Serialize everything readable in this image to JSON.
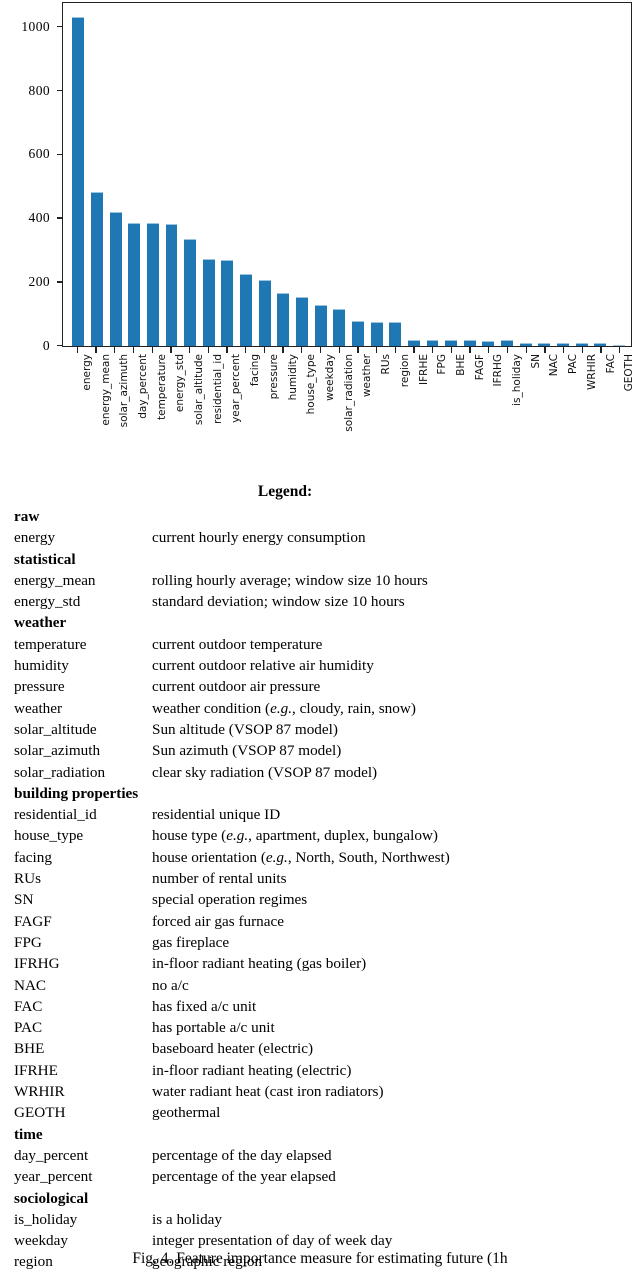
{
  "chart_data": {
    "type": "bar",
    "title": "",
    "xlabel": "",
    "ylabel": "",
    "ylim": [
      0,
      1075
    ],
    "yticks": [
      "0",
      "200",
      "400",
      "600",
      "800",
      "1000"
    ],
    "grid": false,
    "legend_position": "none",
    "bar_color": "#1f77b4",
    "categories": [
      "energy",
      "energy_mean",
      "solar_azimuth",
      "day_percent",
      "temperature",
      "energy_std",
      "solar_altitude",
      "residential_id",
      "year_percent",
      "facing",
      "pressure",
      "humidity",
      "house_type",
      "weekday",
      "solar_radiation",
      "weather",
      "RUs",
      "region",
      "IFRHE",
      "FPG",
      "BHE",
      "FAGF",
      "IFRHG",
      "is_holiday",
      "SN",
      "NAC",
      "PAC",
      "WRHIR",
      "FAC",
      "GEOTH"
    ],
    "values": [
      1034,
      484,
      422,
      388,
      386,
      383,
      337,
      272,
      270,
      227,
      207,
      167,
      153,
      130,
      117,
      80,
      77,
      74,
      20,
      20,
      20,
      18,
      17,
      18,
      10,
      9,
      9,
      10,
      10,
      3
    ]
  },
  "legend": {
    "title": "Legend:",
    "sections": [
      {
        "group": "raw",
        "rows": [
          {
            "term": "energy",
            "desc": "current hourly energy consumption"
          }
        ]
      },
      {
        "group": "statistical",
        "rows": [
          {
            "term": "energy_mean",
            "desc": "rolling hourly average; window size 10 hours"
          },
          {
            "term": "energy_std",
            "desc": "standard deviation; window size 10 hours"
          }
        ]
      },
      {
        "group": "weather",
        "rows": [
          {
            "term": "temperature",
            "desc": "current outdoor temperature"
          },
          {
            "term": "humidity",
            "desc": "current outdoor relative air humidity"
          },
          {
            "term": "pressure",
            "desc": "current outdoor air pressure"
          },
          {
            "term": "weather",
            "desc_html": "weather condition (<i>e.g.</i>, cloudy, rain, snow)"
          },
          {
            "term": "solar_altitude",
            "desc": "Sun altitude (VSOP 87 model)"
          },
          {
            "term": "solar_azimuth",
            "desc": "Sun azimuth (VSOP 87 model)"
          },
          {
            "term": "solar_radiation",
            "desc": "clear sky radiation (VSOP 87 model)"
          }
        ]
      },
      {
        "group": "building properties",
        "rows": [
          {
            "term": "residential_id",
            "desc": "residential unique ID"
          },
          {
            "term": "house_type",
            "desc_html": "house type (<i>e.g.</i>, apartment, duplex, bungalow)"
          },
          {
            "term": "facing",
            "desc_html": "house orientation (<i>e.g.</i>, North, South, Northwest)"
          },
          {
            "term": "RUs",
            "desc": "number of rental units"
          },
          {
            "term": "SN",
            "desc": "special operation regimes"
          },
          {
            "term": "FAGF",
            "desc": "forced air gas furnace"
          },
          {
            "term": "FPG",
            "desc": "gas fireplace"
          },
          {
            "term": "IFRHG",
            "desc": "in-floor radiant heating (gas boiler)"
          },
          {
            "term": "NAC",
            "desc": "no a/c"
          },
          {
            "term": "FAC",
            "desc": "has fixed a/c unit"
          },
          {
            "term": "PAC",
            "desc": "has portable a/c unit"
          },
          {
            "term": "BHE",
            "desc": "baseboard heater (electric)"
          },
          {
            "term": "IFRHE",
            "desc": "in-floor radiant heating (electric)"
          },
          {
            "term": "WRHIR",
            "desc": "water radiant heat (cast iron radiators)"
          },
          {
            "term": "GEOTH",
            "desc": "geothermal"
          }
        ]
      },
      {
        "group": "time",
        "rows": [
          {
            "term": "day_percent",
            "desc": "percentage of the day elapsed"
          },
          {
            "term": "year_percent",
            "desc": "percentage of the year elapsed"
          }
        ]
      },
      {
        "group": "sociological",
        "rows": [
          {
            "term": "is_holiday",
            "desc": "is a holiday"
          },
          {
            "term": "weekday",
            "desc": "integer presentation of day of week day"
          },
          {
            "term": "region",
            "desc": "geographic region"
          }
        ]
      }
    ]
  },
  "caption": {
    "text": "Fig. 4.  Feature importance measure for estimating future (1h"
  }
}
